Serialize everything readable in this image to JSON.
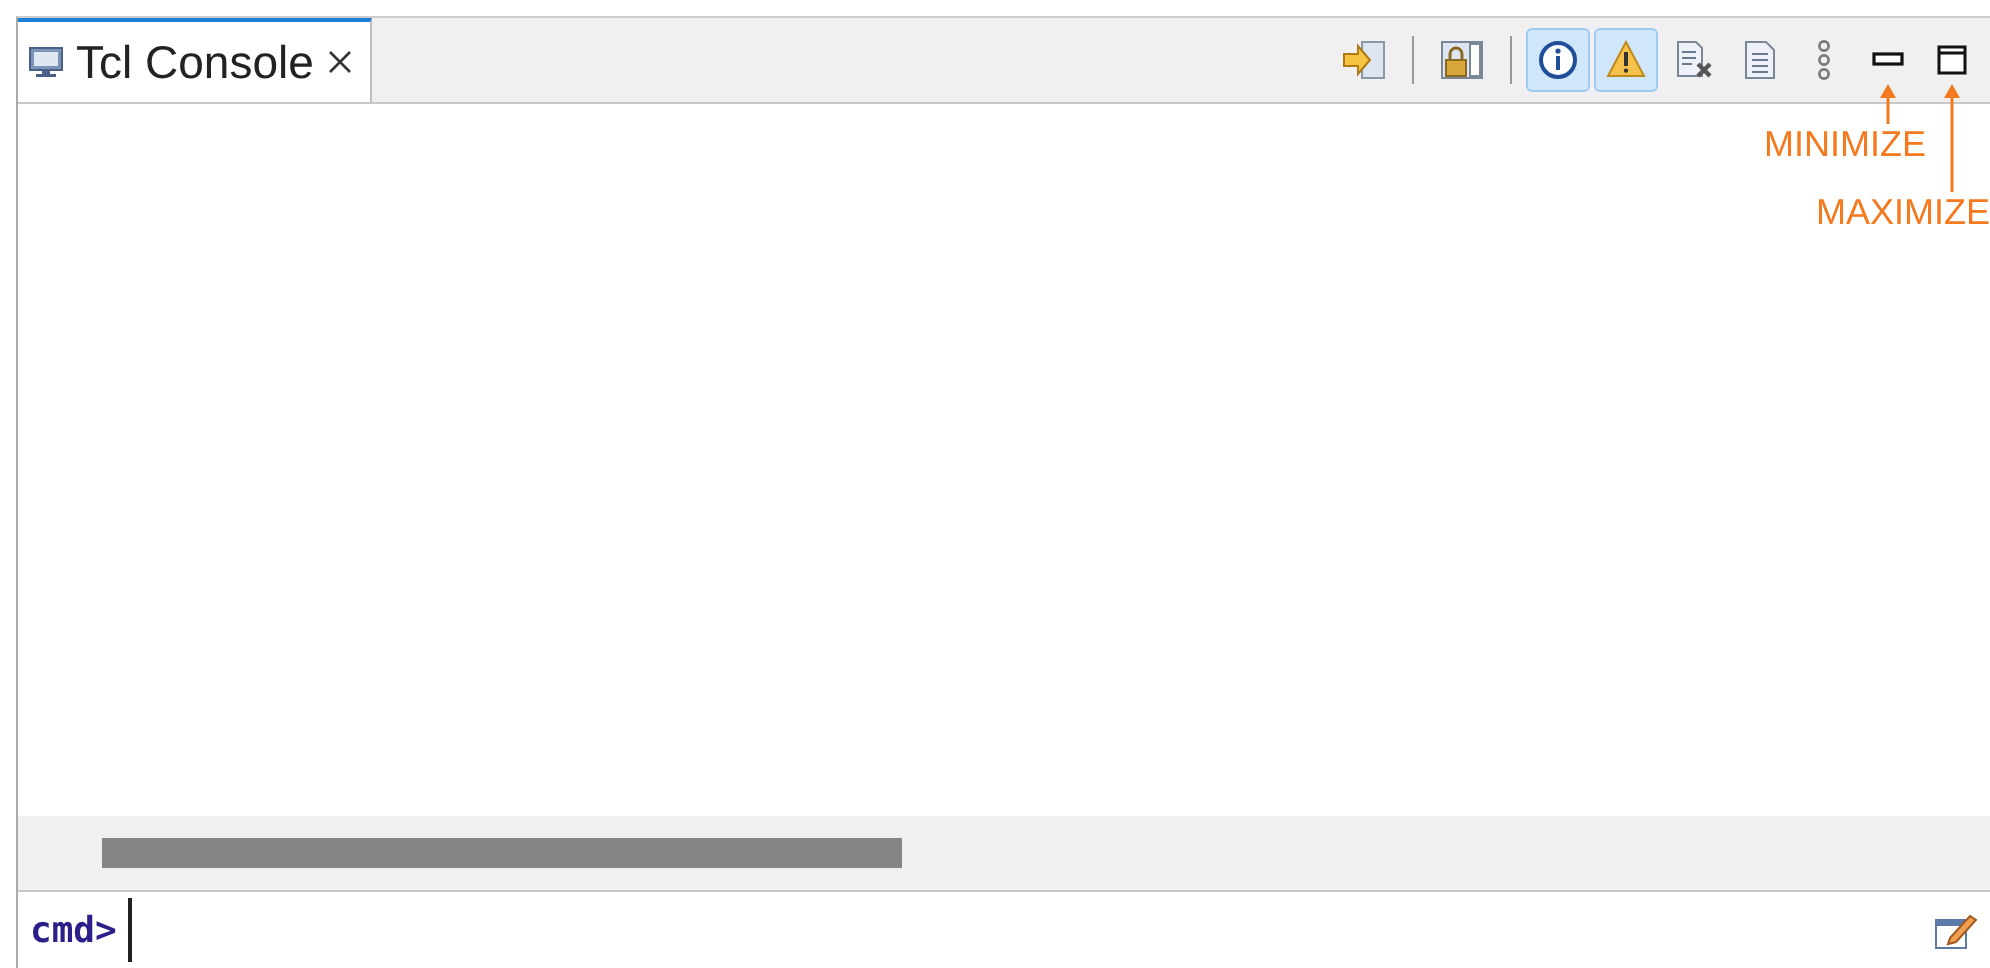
{
  "tab": {
    "label": "Tcl Console",
    "selected": true
  },
  "toolbar_groups": [
    [
      {
        "kind": "pin",
        "selected": false
      }
    ],
    [
      {
        "kind": "lock",
        "selected": false
      }
    ],
    [
      {
        "kind": "info",
        "selected": true
      },
      {
        "kind": "warning",
        "selected": true
      }
    ],
    [
      {
        "kind": "clear",
        "selected": false
      },
      {
        "kind": "log",
        "selected": false
      },
      {
        "kind": "more",
        "selected": false
      },
      {
        "kind": "minimize",
        "selected": false,
        "annotation": "MINIMIZE"
      },
      {
        "kind": "maximize",
        "selected": false,
        "annotation": "MAXIMIZE"
      }
    ]
  ],
  "command_line": {
    "prompt": "cmd>"
  }
}
